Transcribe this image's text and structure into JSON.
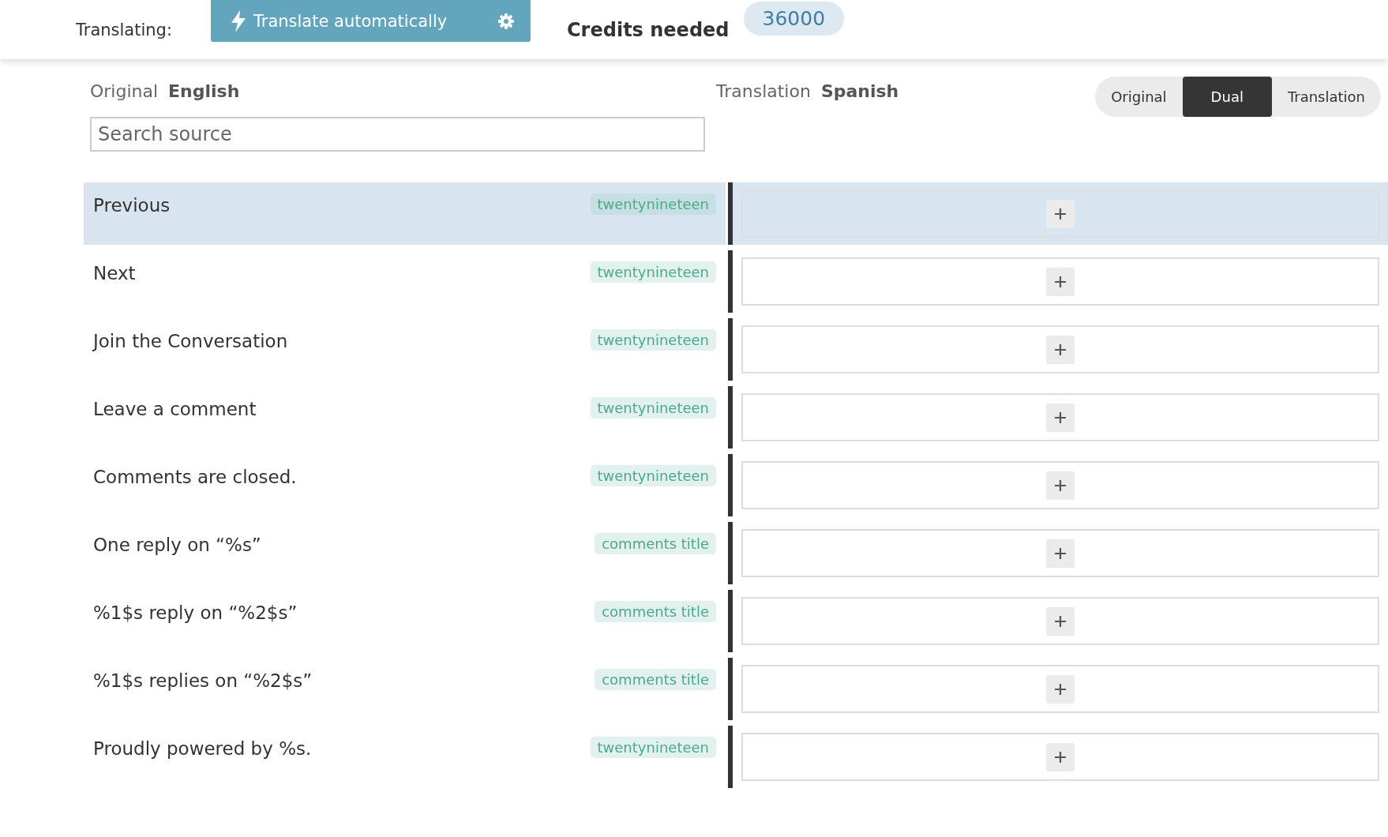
{
  "top_bar": {
    "label": "Translating:",
    "translate_button": "Translate automatically",
    "credits_label": "Credits needed",
    "credits": "36000"
  },
  "original": {
    "label": "Original",
    "language": "English",
    "search": {
      "placeholder": "Search source"
    }
  },
  "translation": {
    "label": "Translation",
    "language": "Spanish"
  },
  "view_modes": [
    {
      "label": "Original",
      "selected": false
    },
    {
      "label": "Dual",
      "selected": true
    },
    {
      "label": "Translation",
      "selected": false
    }
  ],
  "strings": [
    {
      "source": "Previous",
      "tag": "twentynineteen",
      "selected": true
    },
    {
      "source": "Next",
      "tag": "twentynineteen",
      "selected": false
    },
    {
      "source": "Join the Conversation",
      "tag": "twentynineteen",
      "selected": false
    },
    {
      "source": "Leave a comment",
      "tag": "twentynineteen",
      "selected": false
    },
    {
      "source": "Comments are closed.",
      "tag": "twentynineteen",
      "selected": false
    },
    {
      "source": "One reply on “%s”",
      "tag": "comments title",
      "selected": false
    },
    {
      "source": "%1$s reply on “%2$s”",
      "tag": "comments title",
      "selected": false
    },
    {
      "source": "%1$s replies on “%2$s”",
      "tag": "comments title",
      "selected": false
    },
    {
      "source": "Proudly powered by %s.",
      "tag": "twentynineteen",
      "selected": false
    }
  ]
}
